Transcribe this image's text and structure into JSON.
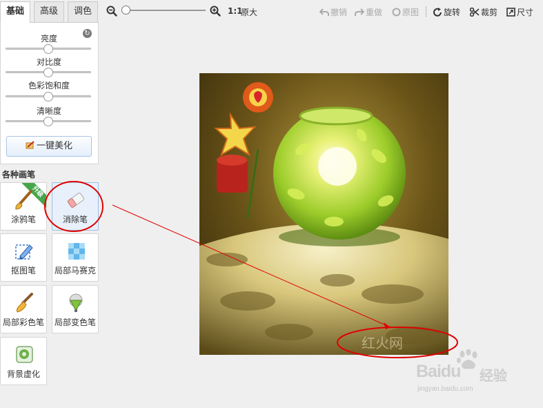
{
  "tabs": [
    {
      "label": "基础",
      "active": true
    },
    {
      "label": "高级",
      "active": false
    },
    {
      "label": "调色",
      "active": false
    }
  ],
  "adjustments": {
    "reset_icon": "refresh-icon",
    "sliders": [
      {
        "label": "亮度",
        "level": 0.5
      },
      {
        "label": "对比度",
        "level": 0.5
      },
      {
        "label": "色彩饱和度",
        "level": 0.5
      },
      {
        "label": "清晰度",
        "level": 0.5
      }
    ],
    "one_click_label": "一键美化"
  },
  "brushes": {
    "title": "各种画笔",
    "upgrade_badge": "升级",
    "items": [
      {
        "label": "涂鸦笔",
        "icon": "brush-icon",
        "selected": false
      },
      {
        "label": "消除笔",
        "icon": "eraser-icon",
        "selected": true
      },
      {
        "label": "抠图笔",
        "icon": "cutout-pen-icon",
        "selected": false
      },
      {
        "label": "局部马赛克",
        "icon": "mosaic-icon",
        "selected": false
      },
      {
        "label": "局部彩色笔",
        "icon": "color-brush-icon",
        "selected": false
      },
      {
        "label": "局部变色笔",
        "icon": "color-change-icon",
        "selected": false
      },
      {
        "label": "背景虚化",
        "icon": "blur-background-icon",
        "selected": false
      }
    ]
  },
  "toolbar": {
    "zoom_ratio": "1:1",
    "original_size": "原大",
    "undo": "撤销",
    "redo": "重做",
    "original": "原图",
    "rotate": "旋转",
    "crop": "裁剪",
    "size": "尺寸"
  },
  "canvas": {
    "watermark": "红火网"
  },
  "branding": {
    "logo_text": "Baidu",
    "logo_cn": "经验",
    "logo_url": "jingyan.baidu.com"
  },
  "colors": {
    "annotation": "#e00000",
    "selected_tool_bg": "#e7f0fb",
    "button_border": "#a9c4e4"
  }
}
